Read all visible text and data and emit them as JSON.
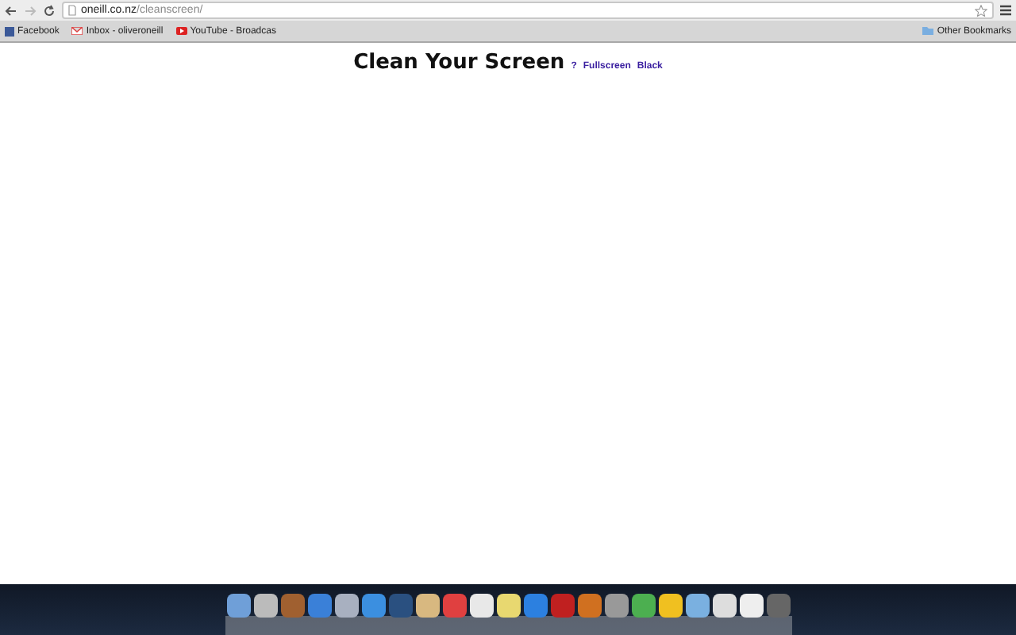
{
  "browser": {
    "url_host": "oneill.co.nz",
    "url_path": "/cleanscreen/"
  },
  "bookmarks": [
    {
      "label": "Facebook",
      "kind": "facebook"
    },
    {
      "label": "Inbox - oliveroneill",
      "kind": "mail"
    },
    {
      "label": "YouTube - Broadcas",
      "kind": "youtube"
    }
  ],
  "other_bookmarks": "Other Bookmarks",
  "page": {
    "title": "Clean Your Screen",
    "links": [
      "?",
      "Fullscreen",
      "Black"
    ]
  }
}
